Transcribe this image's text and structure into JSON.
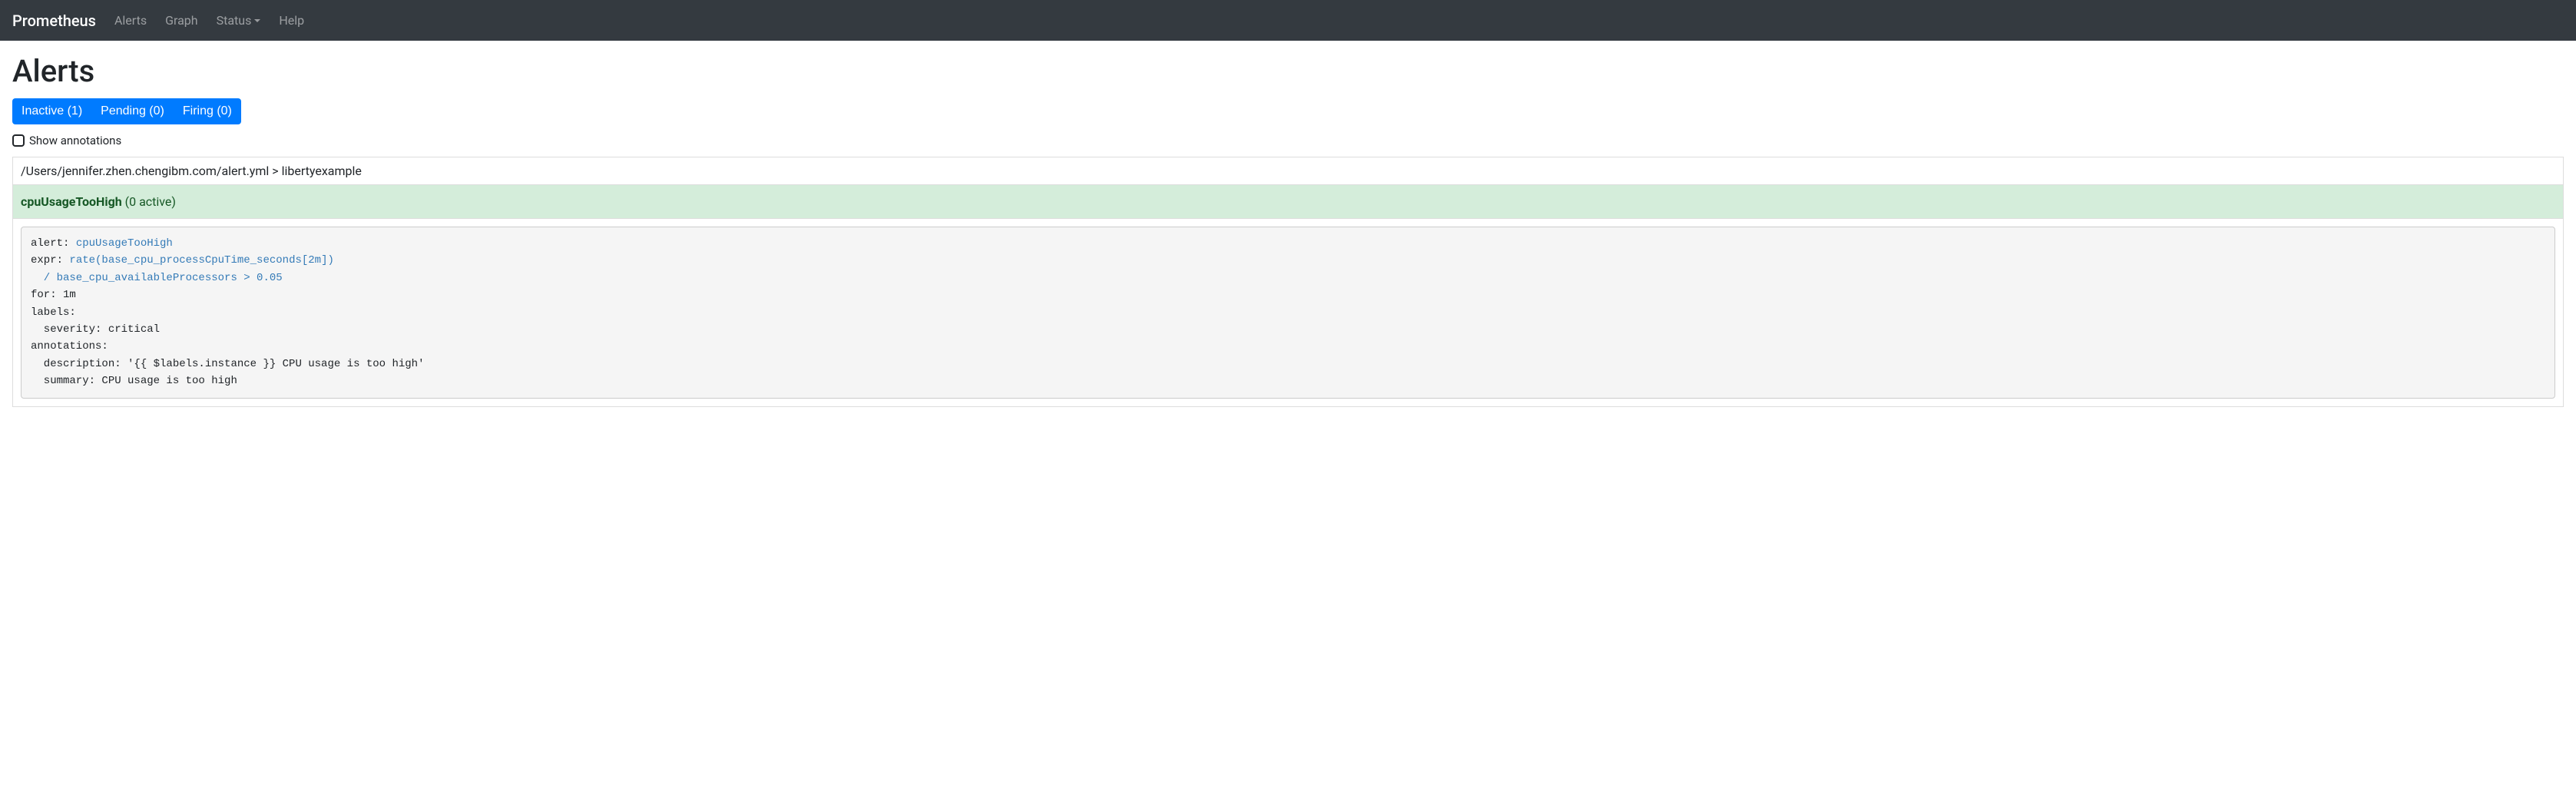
{
  "nav": {
    "brand": "Prometheus",
    "items": [
      {
        "label": "Alerts"
      },
      {
        "label": "Graph"
      },
      {
        "label": "Status",
        "dropdown": true
      },
      {
        "label": "Help"
      }
    ]
  },
  "page": {
    "title": "Alerts"
  },
  "filters": {
    "inactive": "Inactive (1)",
    "pending": "Pending (0)",
    "firing": "Firing (0)"
  },
  "show_annotations": {
    "label": "Show annotations"
  },
  "group": {
    "path": "/Users/jennifer.zhen.chengibm.com/alert.yml > libertyexample"
  },
  "alert": {
    "name": "cpuUsageTooHigh",
    "active_suffix": " (0 active)"
  },
  "rule": {
    "alert_key": "alert: ",
    "alert_val": "cpuUsageTooHigh",
    "expr_key": "expr: ",
    "expr_line1": "rate(base_cpu_processCpuTime_seconds[2m])",
    "expr_line2": "  / base_cpu_availableProcessors > 0.05",
    "rest": "for: 1m\nlabels:\n  severity: critical\nannotations:\n  description: '{{ $labels.instance }} CPU usage is too high'\n  summary: CPU usage is too high"
  }
}
